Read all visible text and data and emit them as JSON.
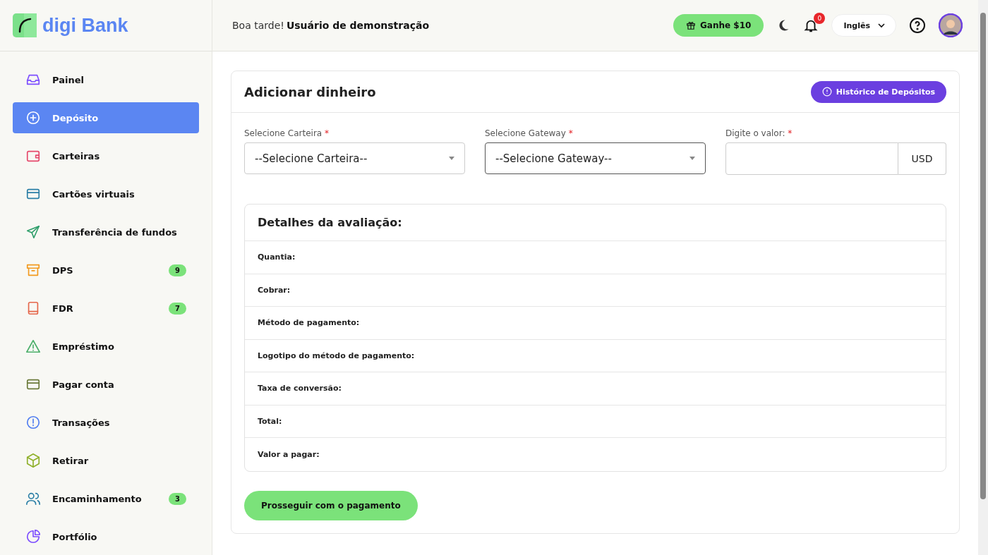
{
  "logo": {
    "text": "digi Bank"
  },
  "header": {
    "greeting": "Boa tarde!",
    "user": "Usuário de demonstração",
    "reward_button": "Ganhe $10",
    "notification_count": "0",
    "language": "Inglês"
  },
  "sidebar": {
    "items": [
      {
        "label": "Painel",
        "kind": "inbox",
        "color": "#7c4dff",
        "selected": false
      },
      {
        "label": "Depósito",
        "kind": "plus",
        "color": "#ffffff",
        "selected": true
      },
      {
        "label": "Carteiras",
        "kind": "wallet",
        "color": "#e5486b",
        "selected": false
      },
      {
        "label": "Cartões virtuais",
        "kind": "card",
        "color": "#2b7fa6",
        "selected": false
      },
      {
        "label": "Transferência de fundos",
        "kind": "send",
        "color": "#2e9e6a",
        "selected": false
      },
      {
        "label": "DPS",
        "kind": "archive",
        "color": "#f29a1f",
        "selected": false,
        "badge": "9"
      },
      {
        "label": "FDR",
        "kind": "book",
        "color": "#e5664a",
        "selected": false,
        "badge": "7"
      },
      {
        "label": "Empréstimo",
        "kind": "warning",
        "color": "#4caf6a",
        "selected": false
      },
      {
        "label": "Pagar conta",
        "kind": "card",
        "color": "#6b7a3a",
        "selected": false
      },
      {
        "label": "Transações",
        "kind": "info",
        "color": "#4f7cf0",
        "selected": false
      },
      {
        "label": "Retirar",
        "kind": "box",
        "color": "#8fb02a",
        "selected": false
      },
      {
        "label": "Encaminhamento",
        "kind": "users",
        "color": "#2b7fa6",
        "selected": false,
        "badge": "3"
      },
      {
        "label": "Portfólio",
        "kind": "pie",
        "color": "#7c4dff",
        "selected": false
      }
    ]
  },
  "card": {
    "title": "Adicionar dinheiro",
    "history_button": "Histórico de Depósitos",
    "fields": [
      {
        "kind": "select",
        "label": "Selecione Carteira",
        "required": "*",
        "value": "--Selecione Carteira--",
        "focused": false
      },
      {
        "kind": "select",
        "label": "Selecione Gateway",
        "required": "*",
        "value": "--Selecione Gateway--",
        "focused": true
      },
      {
        "kind": "amount",
        "label": "Digite o valor:",
        "required": "*",
        "suffix": "USD",
        "focused": false
      }
    ],
    "details": {
      "title": "Detalhes da avaliação:",
      "rows": [
        "Quantia:",
        "Cobrar:",
        "Método de pagamento:",
        "Logotipo do método de pagamento:",
        "Taxa de conversão:",
        "Total:",
        "Valor a pagar:"
      ]
    },
    "submit_button": "Prosseguir com o pagamento"
  }
}
